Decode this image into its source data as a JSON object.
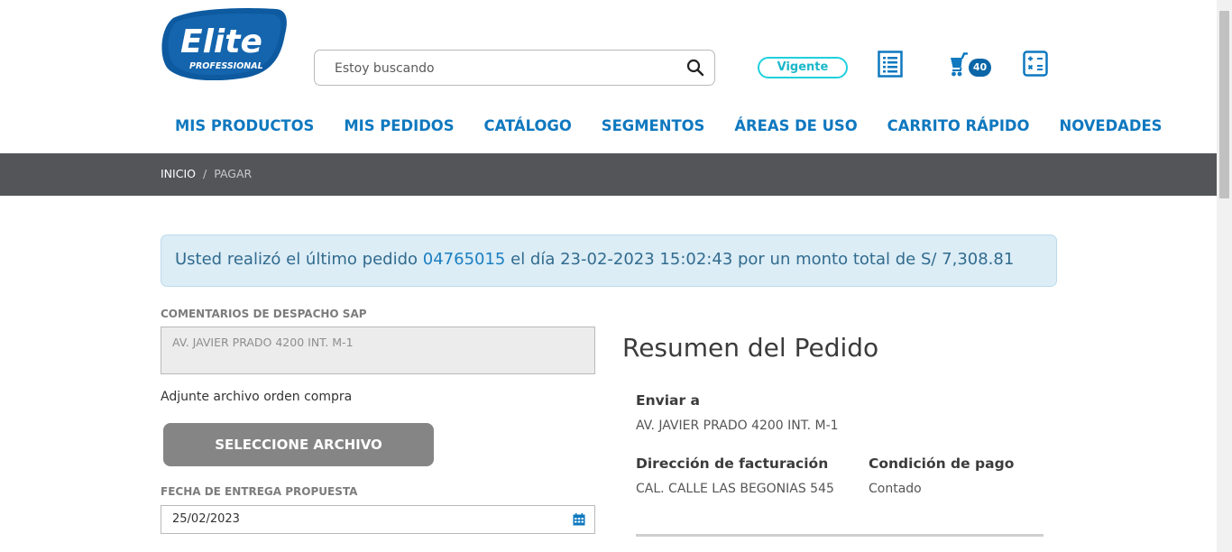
{
  "brand": {
    "logo_main": "Elite",
    "logo_sub": "PROFESSIONAL",
    "primary_color": "#0f78bf",
    "accent_color": "#1fd0dd"
  },
  "search": {
    "placeholder": "Estoy buscando",
    "icon": "search-icon"
  },
  "header": {
    "status_badge": "Vigente",
    "cart_count": "40",
    "icons": [
      "list-icon",
      "cart-icon",
      "calculator-icon"
    ]
  },
  "nav": {
    "items": [
      {
        "label": "MIS PRODUCTOS"
      },
      {
        "label": "MIS PEDIDOS"
      },
      {
        "label": "CATÁLOGO"
      },
      {
        "label": "SEGMENTOS"
      },
      {
        "label": "ÁREAS DE USO"
      },
      {
        "label": "CARRITO RÁPIDO"
      },
      {
        "label": "NOVEDADES"
      }
    ]
  },
  "breadcrumb": {
    "home": "INICIO",
    "separator": "/",
    "current": "PAGAR"
  },
  "alert": {
    "prefix": "Usted realizó el último pedido",
    "order_number": "04765015",
    "middle": "el día 23-02-2023 15:02:43 por un monto total de S/ 7,308.81"
  },
  "form": {
    "comments_label": "COMENTARIOS DE DESPACHO SAP",
    "comments_value": "AV. JAVIER PRADO 4200 INT. M-1",
    "attach_label": "Adjunte archivo orden compra",
    "file_button": "SELECCIONE ARCHIVO",
    "date_label": "FECHA DE ENTREGA PROPUESTA",
    "date_value": "25/02/2023"
  },
  "summary": {
    "title": "Resumen del Pedido",
    "ship_to_label": "Enviar a",
    "ship_to_value": "AV. JAVIER PRADO 4200 INT. M-1",
    "billing_label": "Dirección de facturación",
    "billing_value": "CAL. CALLE LAS BEGONIAS 545",
    "payment_label": "Condición de pago",
    "payment_value": "Contado"
  }
}
